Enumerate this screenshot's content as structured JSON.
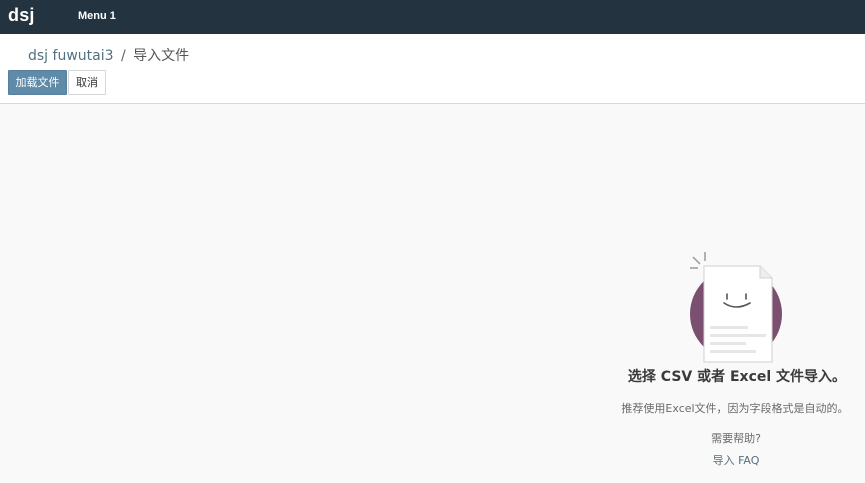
{
  "navbar": {
    "brand": "dsj",
    "menu_item": "Menu 1"
  },
  "breadcrumb": {
    "parent": "dsj fuwutai3",
    "separator": "/",
    "current": "导入文件"
  },
  "toolbar": {
    "load_file_label": "加载文件",
    "cancel_label": "取消"
  },
  "help": {
    "title": "选择 CSV 或者 Excel 文件导入。",
    "tip": "推荐使用Excel文件，因为字段格式是自动的。",
    "need_help": "需要帮助?",
    "faq_link": "导入 FAQ"
  },
  "colors": {
    "navbar_bg": "#243340",
    "primary_button": "#5f8aa8",
    "link": "#52717f",
    "illustration_circle": "#7a4f6f"
  }
}
